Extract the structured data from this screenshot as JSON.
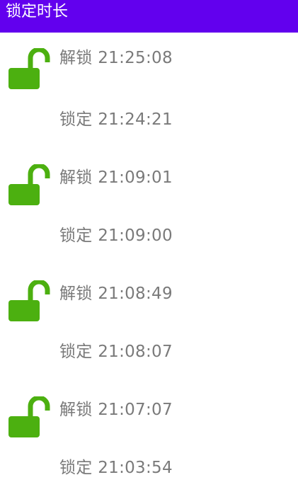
{
  "header": {
    "title": "锁定时长"
  },
  "entries": [
    {
      "label": "解锁 21:25:08",
      "icon": "unlock-icon",
      "icon_color": "#4cb010"
    },
    {
      "label": "锁定 21:24:21",
      "icon": ""
    },
    {
      "label": "解锁 21:09:01",
      "icon": "unlock-icon",
      "icon_color": "#4cb010"
    },
    {
      "label": "锁定 21:09:00",
      "icon": ""
    },
    {
      "label": "解锁 21:08:49",
      "icon": "unlock-icon",
      "icon_color": "#4cb010"
    },
    {
      "label": "锁定 21:08:07",
      "icon": ""
    },
    {
      "label": "解锁 21:07:07",
      "icon": "unlock-icon",
      "icon_color": "#4cb010"
    },
    {
      "label": "锁定 21:03:54",
      "icon": ""
    }
  ],
  "colors": {
    "app_bar": "#6200ee",
    "text": "#7a7a7a",
    "icon": "#4cb010"
  }
}
